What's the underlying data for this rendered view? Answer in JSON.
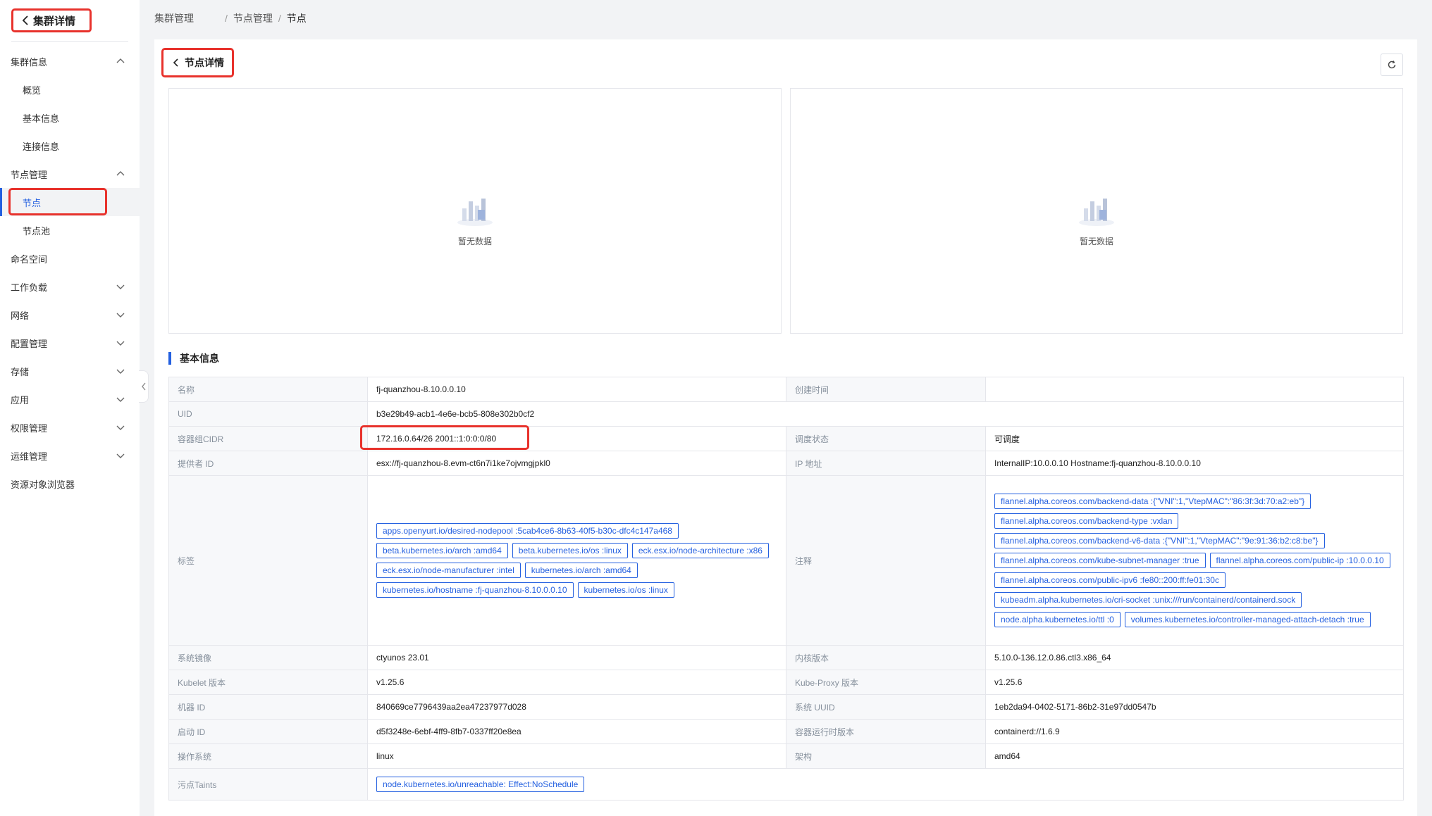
{
  "sidebar": {
    "header": "集群详情",
    "groups": [
      {
        "label": "集群信息",
        "expanded": true,
        "children": [
          "概览",
          "基本信息",
          "连接信息"
        ]
      },
      {
        "label": "节点管理",
        "expanded": true,
        "children": [
          "节点",
          "节点池"
        ]
      },
      {
        "label": "命名空间"
      },
      {
        "label": "工作负载",
        "expanded": false
      },
      {
        "label": "网络",
        "expanded": false
      },
      {
        "label": "配置管理",
        "expanded": false
      },
      {
        "label": "存储",
        "expanded": false
      },
      {
        "label": "应用",
        "expanded": false
      },
      {
        "label": "权限管理",
        "expanded": false
      },
      {
        "label": "运维管理",
        "expanded": false
      },
      {
        "label": "资源对象浏览器"
      }
    ],
    "active_item": "节点"
  },
  "breadcrumb": [
    "集群管理",
    "节点管理",
    "节点"
  ],
  "page": {
    "title": "节点详情",
    "empty_text_left": "暂无数据",
    "empty_text_right": "暂无数据",
    "section_title": "基本信息"
  },
  "info": {
    "name_label": "名称",
    "name": "fj-quanzhou-8.10.0.0.10",
    "created_label": "创建时间",
    "created": "",
    "uid_label": "UID",
    "uid": "b3e29b49-acb1-4e6e-bcb5-808e302b0cf2",
    "cidr_label": "容器组CIDR",
    "cidr": "172.16.0.64/26 2001::1:0:0:0/80",
    "sched_label": "调度状态",
    "sched": "可调度",
    "provider_label": "提供者 ID",
    "provider": "esx://fj-quanzhou-8.evm-ct6n7i1ke7ojvmgjpkl0",
    "ip_label": "IP 地址",
    "ip": "InternalIP:10.0.0.10 Hostname:fj-quanzhou-8.10.0.0.10",
    "labels_label": "标签",
    "labels": [
      "apps.openyurt.io/desired-nodepool :5cab4ce6-8b63-40f5-b30c-dfc4c147a468",
      "beta.kubernetes.io/arch :amd64",
      "beta.kubernetes.io/os :linux",
      "eck.esx.io/node-architecture :x86",
      "eck.esx.io/node-manufacturer :intel",
      "kubernetes.io/arch :amd64",
      "kubernetes.io/hostname :fj-quanzhou-8.10.0.0.10",
      "kubernetes.io/os :linux"
    ],
    "annotations_label": "注释",
    "annotations": [
      "flannel.alpha.coreos.com/backend-data :{\"VNI\":1,\"VtepMAC\":\"86:3f:3d:70:a2:eb\"}",
      "flannel.alpha.coreos.com/backend-type :vxlan",
      "flannel.alpha.coreos.com/backend-v6-data :{\"VNI\":1,\"VtepMAC\":\"9e:91:36:b2:c8:be\"}",
      "flannel.alpha.coreos.com/kube-subnet-manager :true",
      "flannel.alpha.coreos.com/public-ip :10.0.0.10",
      "flannel.alpha.coreos.com/public-ipv6 :fe80::200:ff:fe01:30c",
      "kubeadm.alpha.kubernetes.io/cri-socket :unix:///run/containerd/containerd.sock",
      "node.alpha.kubernetes.io/ttl :0",
      "volumes.kubernetes.io/controller-managed-attach-detach :true"
    ],
    "os_image_label": "系统镜像",
    "os_image": "ctyunos 23.01",
    "kernel_label": "内核版本",
    "kernel": "5.10.0-136.12.0.86.ctl3.x86_64",
    "kubelet_label": "Kubelet 版本",
    "kubelet": "v1.25.6",
    "kubeproxy_label": "Kube-Proxy 版本",
    "kubeproxy": "v1.25.6",
    "machine_label": "机器 ID",
    "machine": "840669ce7796439aa2ea47237977d028",
    "sys_uuid_label": "系统 UUID",
    "sys_uuid": "1eb2da94-0402-5171-86b2-31e97dd0547b",
    "boot_label": "启动 ID",
    "boot": "d5f3248e-6ebf-4ff9-8fb7-0337ff20e8ea",
    "runtime_label": "容器运行时版本",
    "runtime": "containerd://1.6.9",
    "os_label": "操作系统",
    "os": "linux",
    "arch_label": "架构",
    "arch": "amd64",
    "taints_label": "污点Taints",
    "taints": [
      "node.kubernetes.io/unreachable: Effect:NoSchedule"
    ]
  },
  "colors": {
    "accent": "#2460e0",
    "highlight": "#e8322c"
  }
}
